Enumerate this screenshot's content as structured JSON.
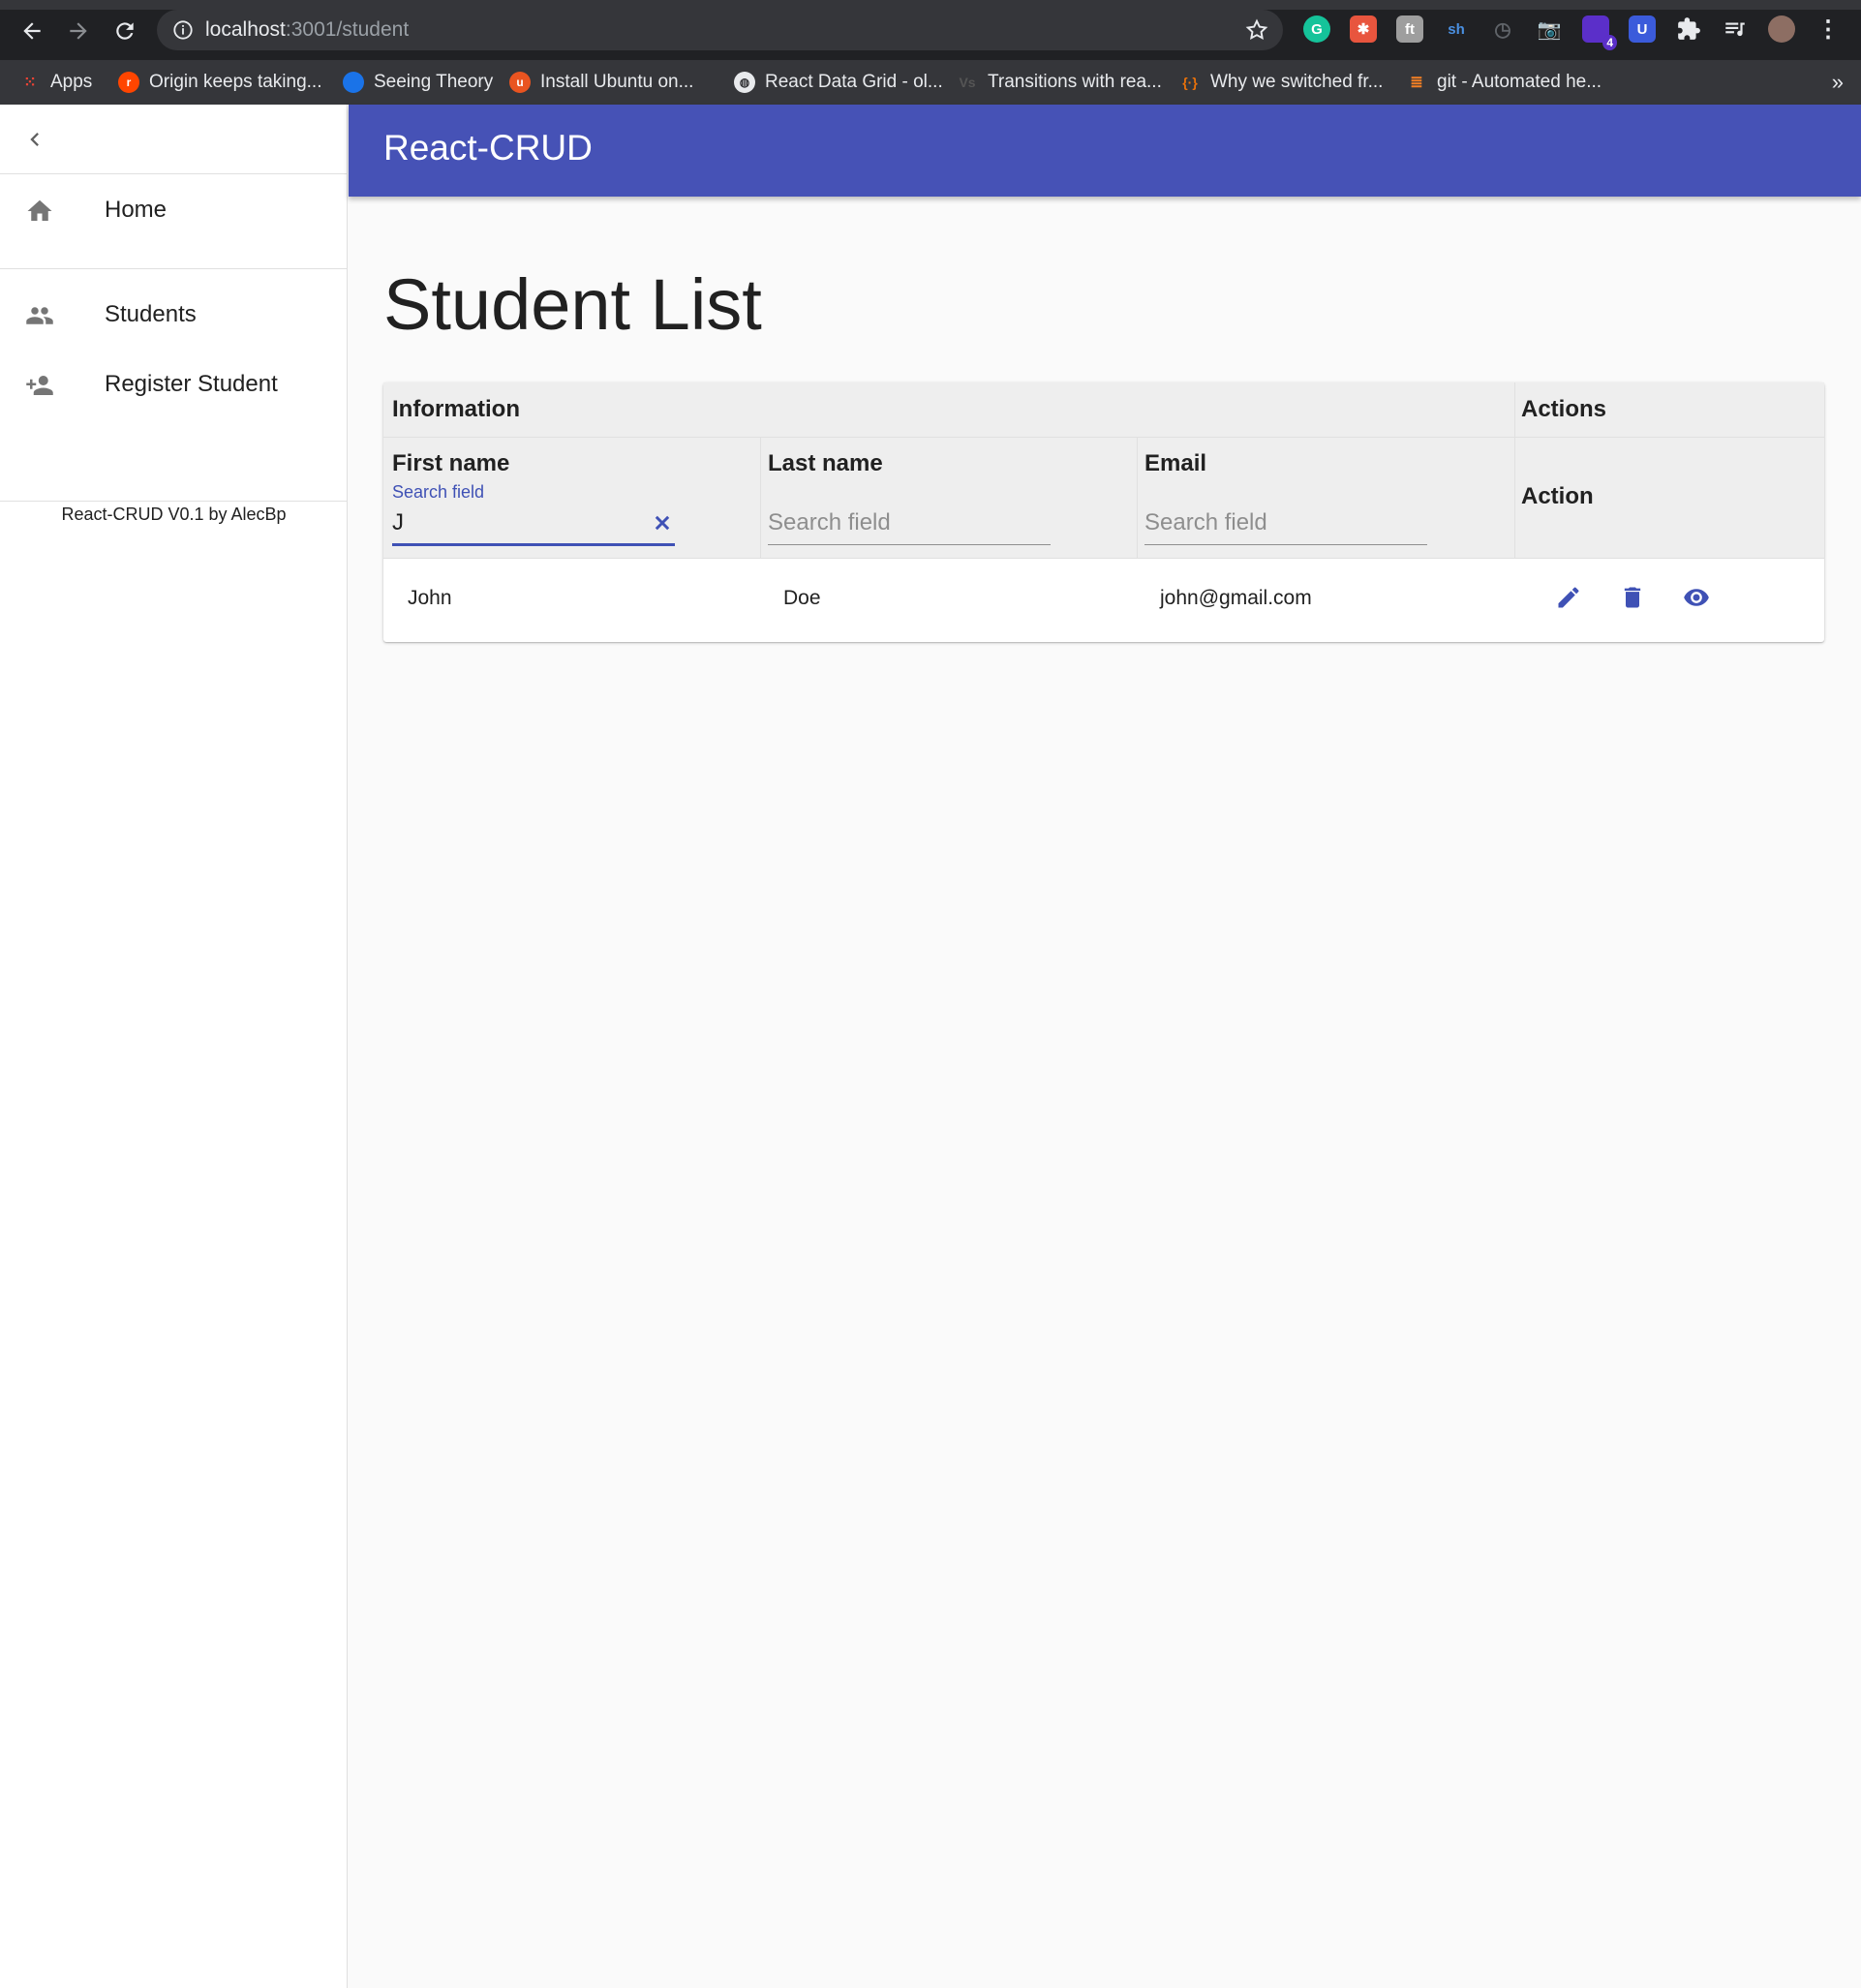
{
  "browser": {
    "url_host": "localhost",
    "url_rest": ":3001/student",
    "bookmarks": [
      {
        "label": "Apps",
        "icon": "apps-grid-icon",
        "color": "#4285f4"
      },
      {
        "label": "Origin keeps taking...",
        "icon": "reddit-icon",
        "color": "#ff4500"
      },
      {
        "label": "Seeing Theory",
        "icon": "circle-icon",
        "color": "#1a73e8"
      },
      {
        "label": "Install Ubuntu on...",
        "icon": "ubuntu-icon",
        "color": "#e95420"
      },
      {
        "label": "React Data Grid - ol...",
        "icon": "globe-icon",
        "color": "#e8eaed"
      },
      {
        "label": "Transitions with rea...",
        "icon": "vs-icon",
        "color": "#555555"
      },
      {
        "label": "Why we switched fr...",
        "icon": "braces-icon",
        "color": "#e8710a"
      },
      {
        "label": "git - Automated he...",
        "icon": "stackoverflow-icon",
        "color": "#f48024"
      }
    ],
    "extension_badge": "4"
  },
  "sidebar": {
    "items": [
      {
        "label": "Home",
        "icon": "home-icon"
      },
      {
        "label": "Students",
        "icon": "people-icon"
      },
      {
        "label": "Register Student",
        "icon": "person-add-icon"
      }
    ],
    "footer": "React-CRUD V0.1 by AlecBp"
  },
  "appbar": {
    "title": "React-CRUD",
    "color": "#4652b6"
  },
  "main": {
    "title": "Student List",
    "table": {
      "group_headers": [
        "Information",
        "Actions"
      ],
      "columns": [
        "First name",
        "Last name",
        "Email",
        "Action"
      ],
      "filters": {
        "first_name": {
          "label": "Search field",
          "value": "J"
        },
        "last_name": {
          "placeholder": "Search field",
          "value": ""
        },
        "email": {
          "placeholder": "Search field",
          "value": ""
        }
      },
      "rows": [
        {
          "first_name": "John",
          "last_name": "Doe",
          "email": "john@gmail.com"
        }
      ]
    },
    "accent_color": "#3f51b5"
  }
}
